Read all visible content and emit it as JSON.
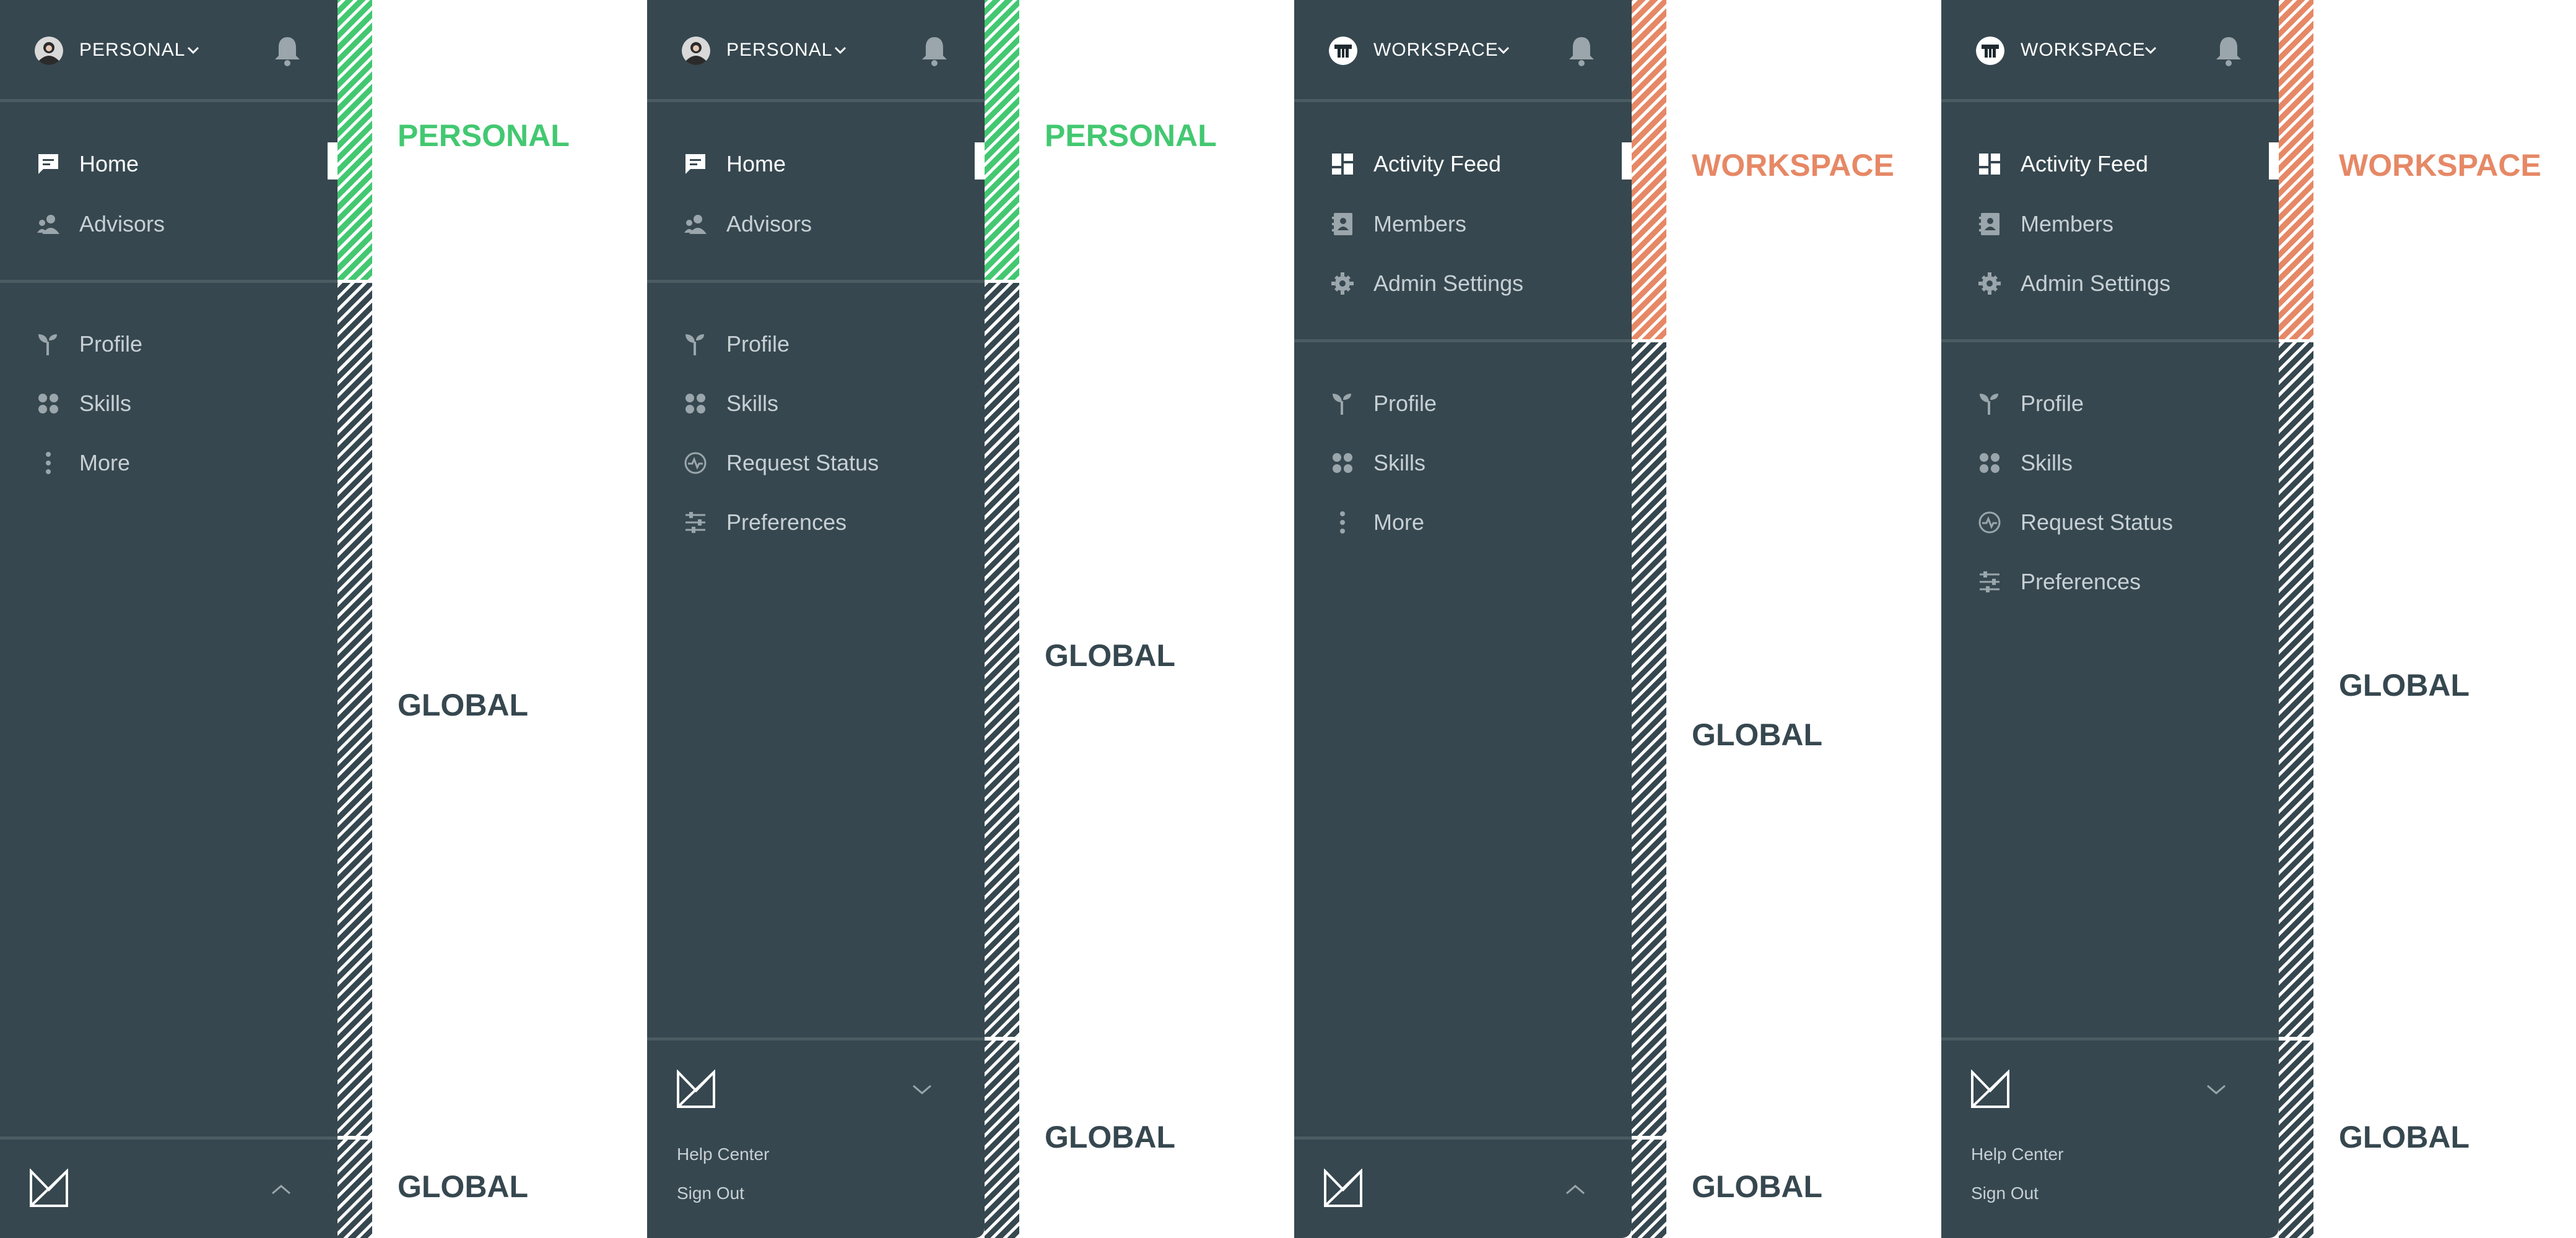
{
  "panels": [
    {
      "switcher_label": "PERSONAL",
      "context_items": [
        {
          "label": "Home",
          "icon": "chat-icon"
        },
        {
          "label": "Advisors",
          "icon": "people-icon"
        }
      ],
      "global_items": [
        {
          "label": "Profile",
          "icon": "sprout-icon"
        },
        {
          "label": "Skills",
          "icon": "grid-icon"
        },
        {
          "label": "More",
          "icon": "more-vertical-icon"
        }
      ],
      "footer": {
        "expanded": false
      },
      "zone_labels": {
        "top": "PERSONAL",
        "middle": "GLOBAL",
        "bottom": "GLOBAL"
      }
    },
    {
      "switcher_label": "PERSONAL",
      "context_items": [
        {
          "label": "Home",
          "icon": "chat-icon"
        },
        {
          "label": "Advisors",
          "icon": "people-icon"
        }
      ],
      "global_items": [
        {
          "label": "Profile",
          "icon": "sprout-icon"
        },
        {
          "label": "Skills",
          "icon": "grid-icon"
        },
        {
          "label": "Request Status",
          "icon": "activity-icon"
        },
        {
          "label": "Preferences",
          "icon": "sliders-icon"
        }
      ],
      "footer": {
        "expanded": true,
        "links": [
          "Help Center",
          "Sign Out"
        ]
      },
      "zone_labels": {
        "top": "PERSONAL",
        "middle": "GLOBAL",
        "bottom": "GLOBAL"
      }
    },
    {
      "switcher_label": "WORKSPACE",
      "context_items": [
        {
          "label": "Activity Feed",
          "icon": "dashboard-icon"
        },
        {
          "label": "Members",
          "icon": "contacts-icon"
        },
        {
          "label": "Admin Settings",
          "icon": "gear-icon"
        }
      ],
      "global_items": [
        {
          "label": "Profile",
          "icon": "sprout-icon"
        },
        {
          "label": "Skills",
          "icon": "grid-icon"
        },
        {
          "label": "More",
          "icon": "more-vertical-icon"
        }
      ],
      "footer": {
        "expanded": false
      },
      "zone_labels": {
        "top": "WORKSPACE",
        "middle": "GLOBAL",
        "bottom": "GLOBAL"
      }
    },
    {
      "switcher_label": "WORKSPACE",
      "context_items": [
        {
          "label": "Activity Feed",
          "icon": "dashboard-icon"
        },
        {
          "label": "Members",
          "icon": "contacts-icon"
        },
        {
          "label": "Admin Settings",
          "icon": "gear-icon"
        }
      ],
      "global_items": [
        {
          "label": "Profile",
          "icon": "sprout-icon"
        },
        {
          "label": "Skills",
          "icon": "grid-icon"
        },
        {
          "label": "Request Status",
          "icon": "activity-icon"
        },
        {
          "label": "Preferences",
          "icon": "sliders-icon"
        }
      ],
      "footer": {
        "expanded": true,
        "links": [
          "Help Center",
          "Sign Out"
        ]
      },
      "zone_labels": {
        "top": "WORKSPACE",
        "middle": "GLOBAL",
        "bottom": "GLOBAL"
      }
    }
  ],
  "colors": {
    "sidebar_bg": "#36474f",
    "divider": "#4b5c63",
    "personal_accent": "#43c871",
    "workspace_accent": "#e68866",
    "text_active": "#ffffff",
    "text_muted": "#c7d0d4"
  }
}
